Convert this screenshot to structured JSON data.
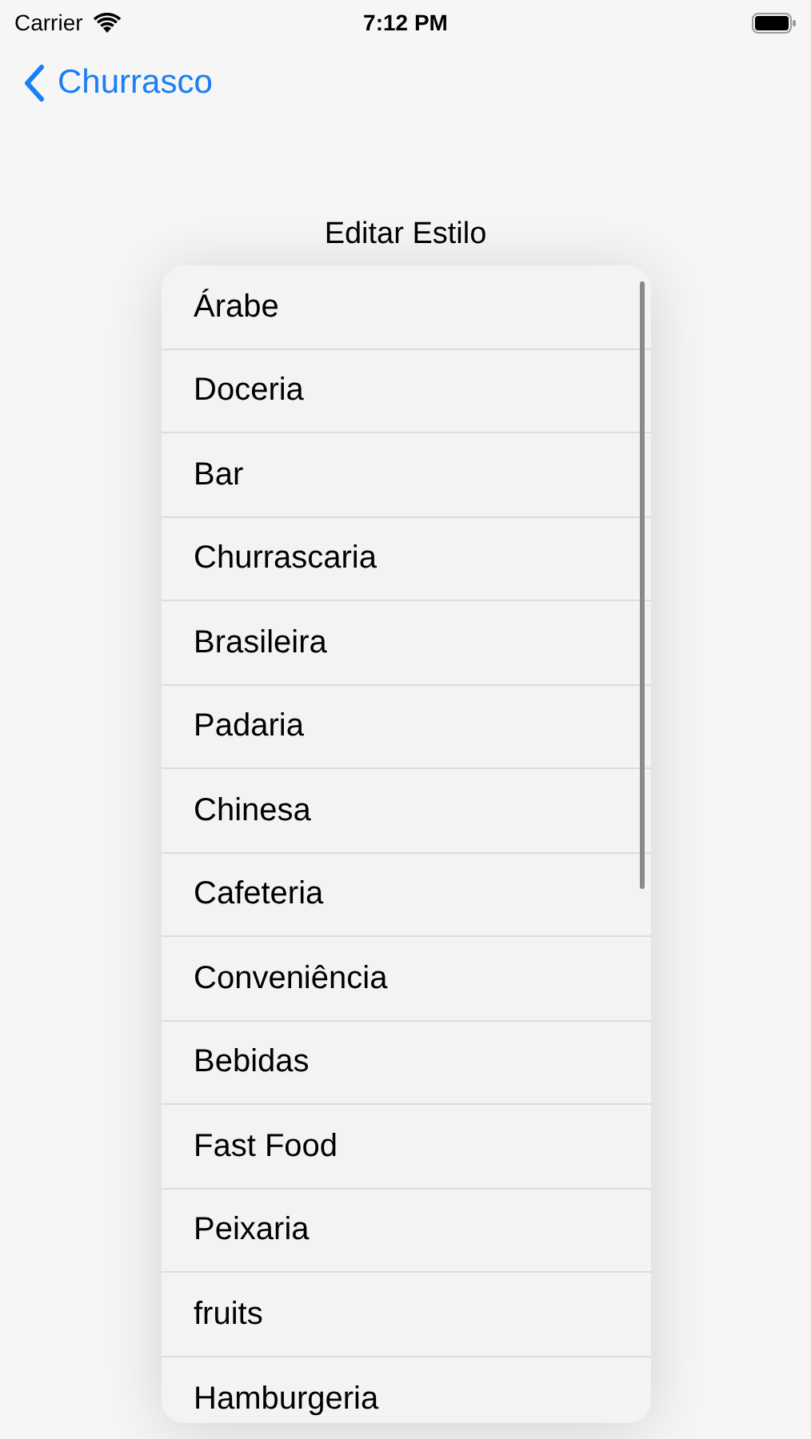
{
  "status_bar": {
    "carrier": "Carrier",
    "time": "7:12 PM"
  },
  "nav": {
    "back_label": "Churrasco",
    "title": "Editar Estilo"
  },
  "menu": {
    "items": [
      {
        "label": "Árabe"
      },
      {
        "label": "Doceria"
      },
      {
        "label": "Bar"
      },
      {
        "label": "Churrascaria"
      },
      {
        "label": "Brasileira"
      },
      {
        "label": "Padaria"
      },
      {
        "label": "Chinesa"
      },
      {
        "label": "Cafeteria"
      },
      {
        "label": "Conveniência"
      },
      {
        "label": "Bebidas"
      },
      {
        "label": "Fast Food"
      },
      {
        "label": "Peixaria"
      },
      {
        "label": "fruits"
      },
      {
        "label": "Hamburgeria"
      }
    ]
  }
}
